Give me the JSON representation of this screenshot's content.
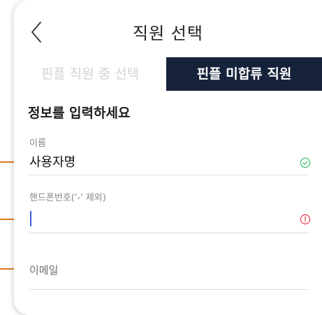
{
  "header": {
    "title": "직원 선택",
    "back_icon": "chevron-left-icon"
  },
  "tabs": [
    {
      "label": "핀플 직원 중 선택",
      "active": false
    },
    {
      "label": "핀플 미합류 직원",
      "active": true
    }
  ],
  "form": {
    "section_title": "정보를 입력하세요",
    "name": {
      "label": "이름",
      "value": "사용자명",
      "status_icon": "check-circle-icon",
      "status_color": "#3fbf6a"
    },
    "phone": {
      "label": "핸드폰번호('-' 제외)",
      "value": "",
      "status_icon": "alert-circle-icon",
      "status_color": "#e8424c"
    },
    "email": {
      "placeholder": "이메일"
    }
  },
  "colors": {
    "tab_active_bg": "#16223a",
    "tab_inactive_text": "#d2d2d2",
    "annotation_pointer": "#e07a1f",
    "caret": "#3a5be0"
  }
}
